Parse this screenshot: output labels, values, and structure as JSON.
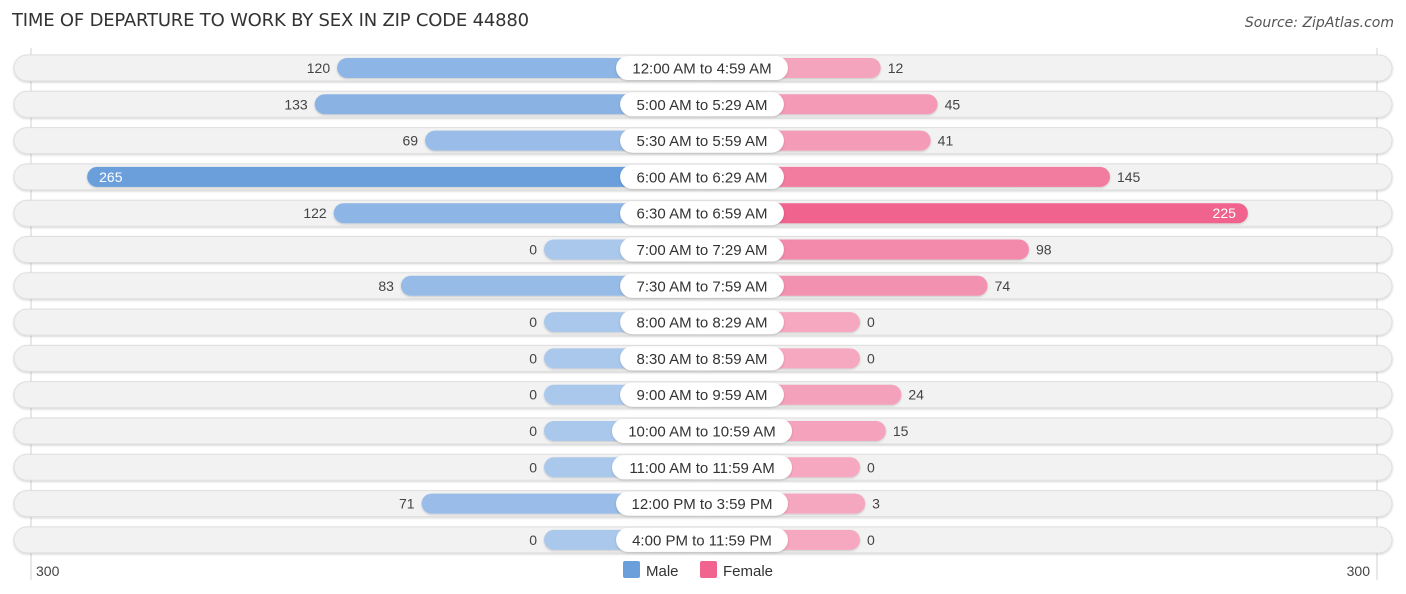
{
  "title": "TIME OF DEPARTURE TO WORK BY SEX IN ZIP CODE 44880",
  "source": "Source: ZipAtlas.com",
  "colors": {
    "male": "#6a9fdc",
    "male_light": "#aac8ec",
    "female": "#f0648f",
    "female_light": "#f5a8c0",
    "row_bg": "#f2f2f2"
  },
  "chart_data": {
    "type": "bar",
    "orientation": "horizontal-diverging",
    "title": "TIME OF DEPARTURE TO WORK BY SEX IN ZIP CODE 44880",
    "categories": [
      "12:00 AM to 4:59 AM",
      "5:00 AM to 5:29 AM",
      "5:30 AM to 5:59 AM",
      "6:00 AM to 6:29 AM",
      "6:30 AM to 6:59 AM",
      "7:00 AM to 7:29 AM",
      "7:30 AM to 7:59 AM",
      "8:00 AM to 8:29 AM",
      "8:30 AM to 8:59 AM",
      "9:00 AM to 9:59 AM",
      "10:00 AM to 10:59 AM",
      "11:00 AM to 11:59 AM",
      "12:00 PM to 3:59 PM",
      "4:00 PM to 11:59 PM"
    ],
    "series": [
      {
        "name": "Male",
        "side": "left",
        "values": [
          120,
          133,
          69,
          265,
          122,
          0,
          83,
          0,
          0,
          0,
          0,
          0,
          71,
          0
        ]
      },
      {
        "name": "Female",
        "side": "right",
        "values": [
          12,
          45,
          41,
          145,
          225,
          98,
          74,
          0,
          0,
          24,
          15,
          0,
          3,
          0
        ]
      }
    ],
    "axis": {
      "left_label": "300",
      "right_label": "300",
      "max": 300
    },
    "legend": {
      "position": "bottom-center",
      "items": [
        "Male",
        "Female"
      ]
    },
    "grid": false
  }
}
